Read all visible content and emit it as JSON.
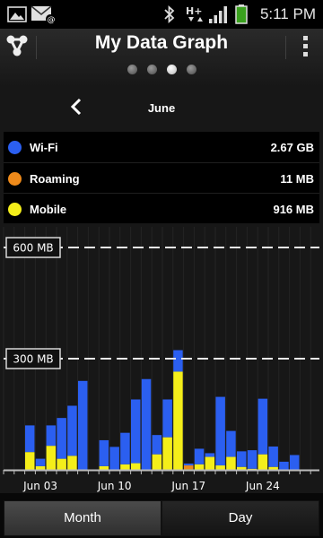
{
  "status_bar": {
    "time": "5:11 PM",
    "icons": [
      "gallery-icon",
      "email-icon",
      "bluetooth-icon",
      "hplus-network-icon",
      "signal-icon",
      "battery-icon"
    ],
    "network_type": "H+"
  },
  "app_bar": {
    "title": "My Data Graph",
    "logo_icon": "app-logo-icon",
    "menu_icon": "overflow-menu-icon",
    "pages": {
      "count": 4,
      "active_index": 2
    }
  },
  "month_nav": {
    "label": "June",
    "prev_icon": "chevron-left-icon"
  },
  "legend": [
    {
      "label": "Wi-Fi",
      "value": "2.67 GB",
      "color": "#2b5ff0"
    },
    {
      "label": "Roaming",
      "value": "11 MB",
      "color": "#ee8a1a"
    },
    {
      "label": "Mobile",
      "value": "916 MB",
      "color": "#f4ee1a"
    }
  ],
  "chart_data": {
    "type": "bar",
    "stacked": true,
    "x_ticks": [
      "Jun 03",
      "Jun 10",
      "Jun 17",
      "Jun 24"
    ],
    "x_tick_days": [
      3,
      10,
      17,
      24
    ],
    "days": [
      2,
      3,
      4,
      5,
      6,
      7,
      8,
      9,
      10,
      11,
      12,
      13,
      14,
      15,
      16,
      17,
      18,
      19,
      20,
      21,
      22,
      23,
      24,
      25,
      26,
      27
    ],
    "reference_lines": [
      {
        "label": "600 MB",
        "value": 600
      },
      {
        "label": "300 MB",
        "value": 300
      }
    ],
    "y_unit": "MB",
    "ylim": [
      0,
      625
    ],
    "series": [
      {
        "name": "Wi-Fi",
        "color": "#2b5ff0",
        "values": [
          72,
          20,
          55,
          110,
          135,
          240,
          0,
          70,
          62,
          85,
          172,
          245,
          52,
          102,
          58,
          5,
          42,
          10,
          185,
          70,
          42,
          50,
          150,
          55,
          22,
          40
        ]
      },
      {
        "name": "Roaming",
        "color": "#ee8a1a",
        "values": [
          0,
          0,
          0,
          0,
          0,
          0,
          0,
          0,
          0,
          0,
          0,
          0,
          0,
          0,
          0,
          10,
          0,
          0,
          0,
          0,
          0,
          0,
          0,
          0,
          0,
          0
        ]
      },
      {
        "name": "Mobile",
        "color": "#f4ee1a",
        "values": [
          48,
          10,
          65,
          30,
          38,
          0,
          0,
          10,
          0,
          15,
          18,
          0,
          42,
          88,
          265,
          2,
          15,
          35,
          12,
          35,
          8,
          3,
          42,
          8,
          0,
          0
        ]
      }
    ]
  },
  "bottom_tabs": [
    {
      "label": "Month",
      "selected": true
    },
    {
      "label": "Day",
      "selected": false
    }
  ]
}
